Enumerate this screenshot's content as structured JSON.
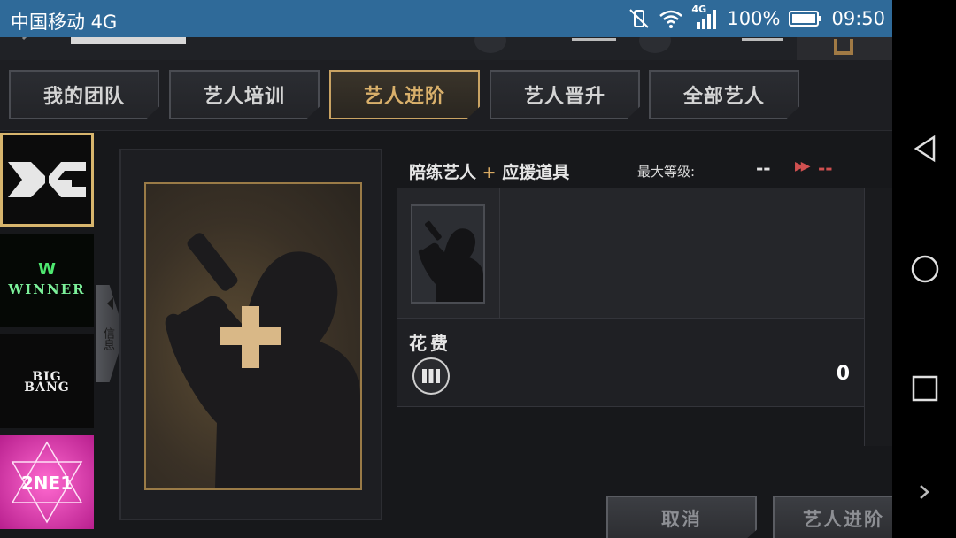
{
  "status_bar": {
    "carrier": "中国移动 4G",
    "network_small": "4G",
    "battery_percent": "100%",
    "time": "09:50"
  },
  "tabs": [
    {
      "label": "我的团队",
      "active": false
    },
    {
      "label": "艺人培训",
      "active": false
    },
    {
      "label": "艺人进阶",
      "active": true
    },
    {
      "label": "艺人晋升",
      "active": false
    },
    {
      "label": "全部艺人",
      "active": false
    }
  ],
  "groups": [
    {
      "name": "YG",
      "selected": true
    },
    {
      "name": "WINNER",
      "selected": false
    },
    {
      "name": "BIGBANG",
      "selected": false
    },
    {
      "name": "2NE1",
      "selected": false
    }
  ],
  "info_tab_label": "信息",
  "ingredient": {
    "title_part1": "陪练艺人",
    "title_plus": "+",
    "title_part2": "应援道具"
  },
  "max_level": {
    "label": "最大等级:",
    "current": "--",
    "next": "--"
  },
  "cost": {
    "label": "花费",
    "value": "0"
  },
  "buttons": {
    "cancel": "取消",
    "advance": "艺人进阶"
  },
  "colors": {
    "status_bar": "#2f6a99",
    "accent_gold": "#c9a363",
    "level_red": "#d05050"
  }
}
